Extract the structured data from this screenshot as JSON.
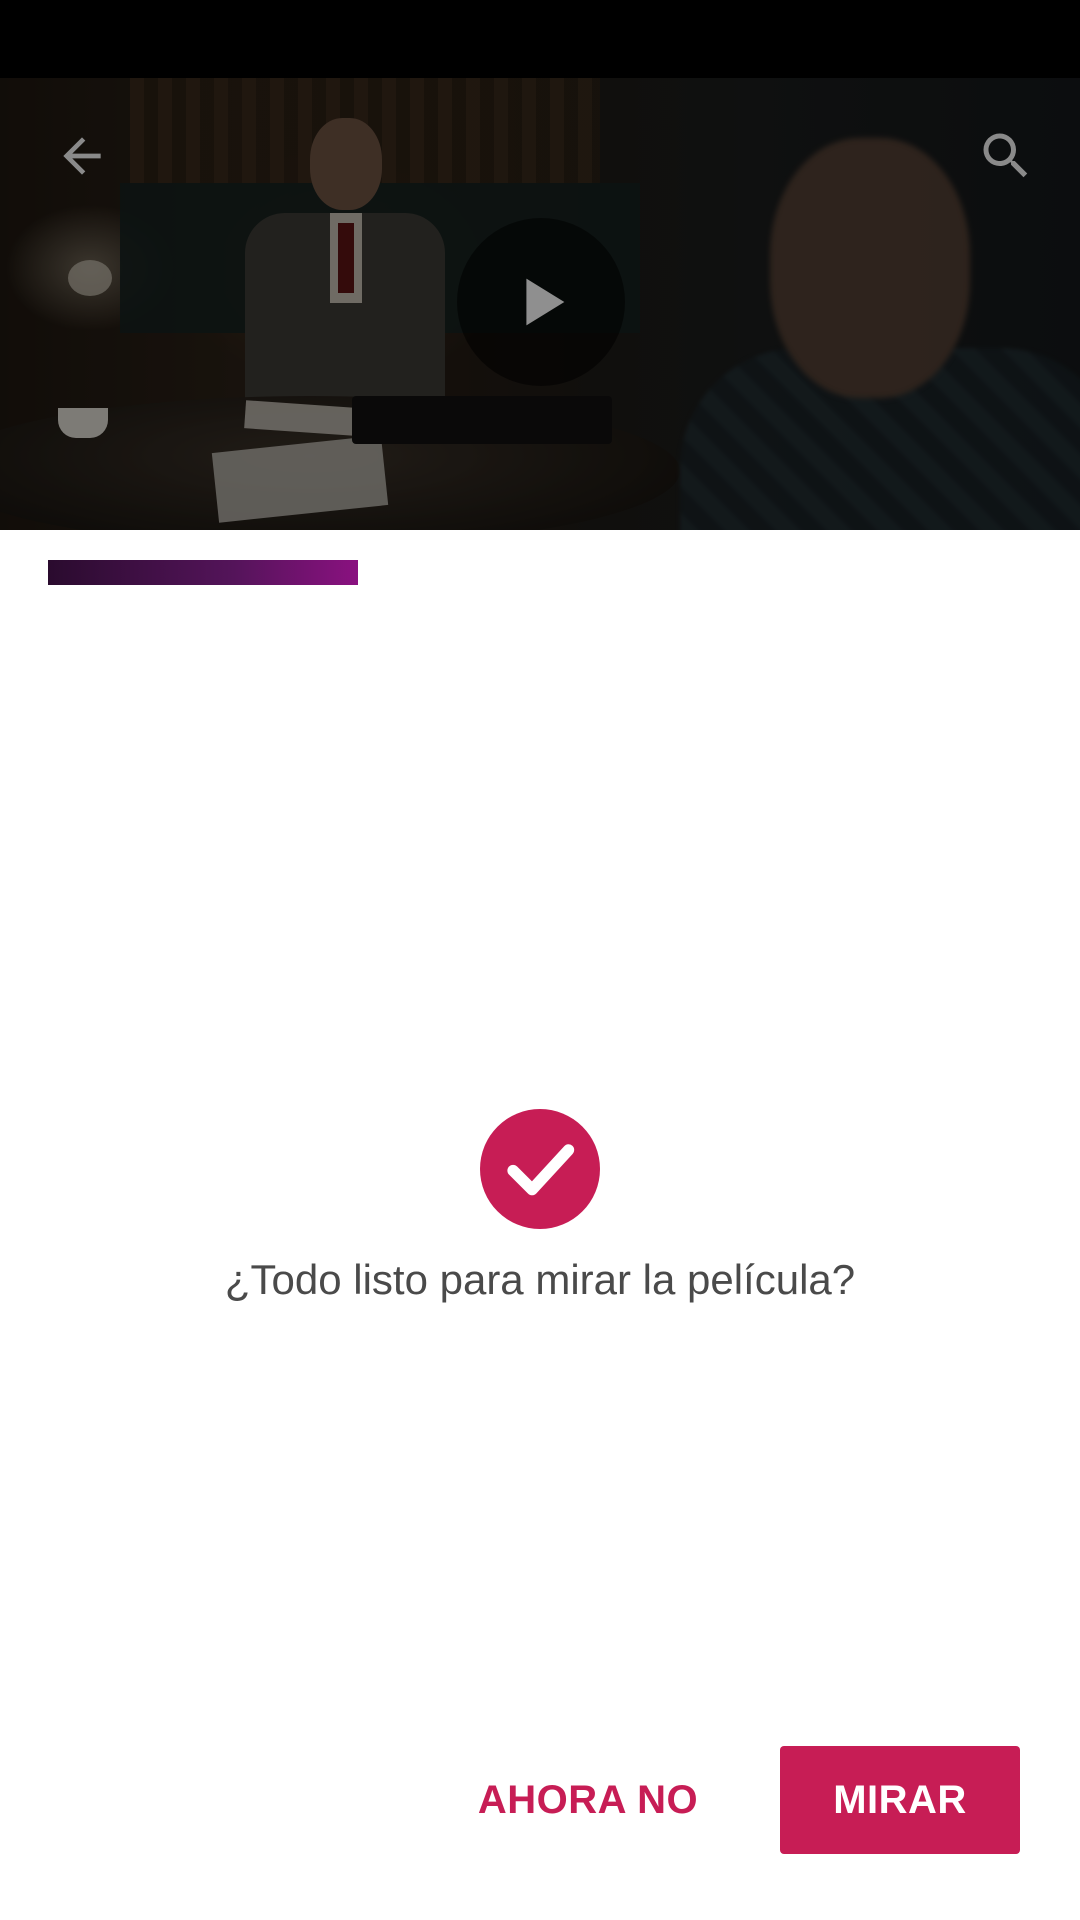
{
  "theme": {
    "accent": "#c71d55",
    "text_secondary": "#4a4a4a"
  },
  "player": {
    "back_icon": "arrow-back-icon",
    "search_icon": "search-icon",
    "play_icon": "play-icon"
  },
  "dialog": {
    "status_icon": "check-circle-icon",
    "message": "¿Todo listo para mirar la película?",
    "secondary_label": "AHORA NO",
    "primary_label": "MIRAR"
  }
}
